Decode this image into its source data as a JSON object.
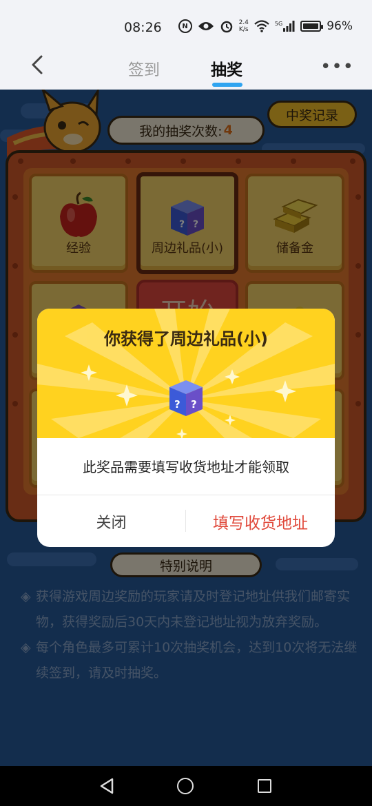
{
  "status_bar": {
    "time": "08:26",
    "speed_top": "2.4",
    "speed_unit": "K/s",
    "network": "5G",
    "battery": "96%"
  },
  "nav": {
    "tabs": [
      {
        "label": "签到",
        "active": false
      },
      {
        "label": "抽奖",
        "active": true
      }
    ],
    "accent_color": "#2fa4f0"
  },
  "lottery": {
    "record_button": "中奖记录",
    "count_label": "我的抽奖次数:",
    "count_value": "4",
    "prizes": [
      {
        "label": "经验",
        "icon": "apple-icon"
      },
      {
        "label": "周边礼品(小)",
        "icon": "mystery-box-icon",
        "selected": true
      },
      {
        "label": "储备金",
        "icon": "gold-bars-icon"
      }
    ],
    "start_button": "开始"
  },
  "special": {
    "title": "特别说明",
    "notes": [
      "获得游戏周边奖励的玩家请及时登记地址供我们邮寄实物，获得奖励后30天内未登记地址视为放弃奖励。",
      "每个角色最多可累计10次抽奖机会，达到10次将无法继续签到，请及时抽奖。"
    ]
  },
  "dialog": {
    "title": "你获得了周边礼品(小)",
    "message": "此奖品需要填写收货地址才能领取",
    "close_button": "关闭",
    "confirm_button": "填写收货地址",
    "confirm_color": "#e0483a"
  }
}
